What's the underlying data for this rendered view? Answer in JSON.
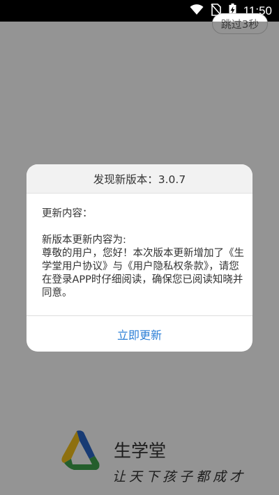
{
  "status_bar": {
    "time": "11:50",
    "icons": [
      "wifi-icon",
      "no-sim-icon",
      "battery-charging-icon"
    ]
  },
  "splash": {
    "skip_label": "跳过3秒",
    "app_name": "生学堂",
    "slogan": "让天下孩子都成才",
    "logo_colors": [
      "#2a67c9",
      "#f5c21a",
      "#3fa34d"
    ]
  },
  "dialog": {
    "title": "发现新版本：3.0.7",
    "content_label": "更新内容：",
    "content_text": "新版本更新内容为:\n尊敬的用户，您好！本次版本更新增加了《生学堂用户协议》与《用户隐私权条款》，请您在登录APP时仔细阅读，确保您已阅读知晓并同意。",
    "action_label": "立即更新",
    "action_color": "#2c7fd6"
  }
}
